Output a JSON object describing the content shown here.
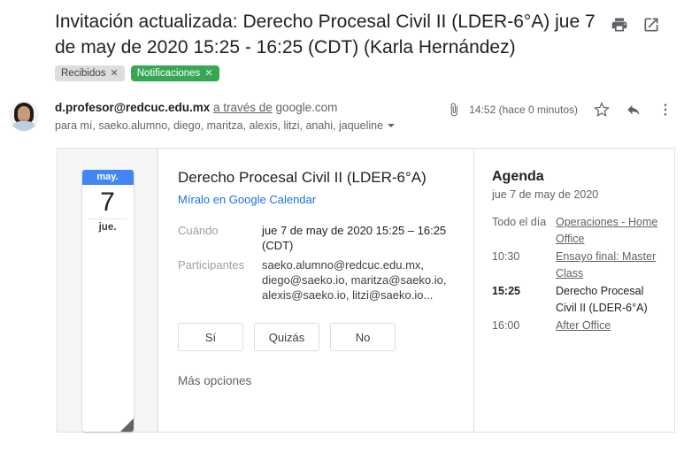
{
  "header": {
    "subject": "Invitación actualizada: Derecho Procesal Civil II (LDER-6°A) jue 7 de may de 2020 15:25 - 16:25 (CDT) (Karla Hernández)",
    "print_icon": "print-icon",
    "open_in_new_icon": "open-in-new-window-icon"
  },
  "labels": [
    {
      "text": "Recibidos",
      "remove": "✕",
      "color": "#ddddde"
    },
    {
      "text": "Notificaciones",
      "remove": "✕",
      "color": "#36a853"
    }
  ],
  "sender": {
    "address": "d.profesor@redcuc.edu.mx",
    "via": "a través de",
    "domain": "google.com",
    "recipients": "para mí, saeko.alumno, diego, maritza, alexis, litzi, anahi, jaqueline",
    "timestamp": "14:52 (hace 0 minutos)",
    "attachment_icon": "paperclip-icon",
    "star_icon": "star-icon",
    "reply_icon": "reply-icon",
    "more_icon": "more-options-icon",
    "avatar": "sender-avatar-photo"
  },
  "invite": {
    "date_card": {
      "month": "may.",
      "day": "7",
      "weekday": "jue."
    },
    "title": "Derecho Procesal Civil II (LDER-6°A)",
    "calendar_link": "Míralo en Google Calendar",
    "details": [
      {
        "label": "Cuándo",
        "value": "jue 7 de may de 2020 15:25 – 16:25 (CDT)",
        "strong": true
      },
      {
        "label": "Participantes",
        "value": "saeko.alumno@redcuc.edu.mx, diego@saeko.io, maritza@saeko.io, alexis@saeko.io, litzi@saeko.io...",
        "strong": false
      }
    ],
    "rsvp": [
      {
        "label": "Sí"
      },
      {
        "label": "Quizás"
      },
      {
        "label": "No"
      }
    ],
    "more_options": "Más opciones"
  },
  "agenda": {
    "title": "Agenda",
    "date": "jue 7 de may de 2020",
    "rows": [
      {
        "time": "Todo el día",
        "name": "Operaciones - Home Office",
        "current": false
      },
      {
        "time": "10:30",
        "name": "Ensayo final: Master Class",
        "current": false
      },
      {
        "time": "15:25",
        "name": "Derecho Procesal Civil II (LDER-6°A)",
        "current": true
      },
      {
        "time": "16:00",
        "name": "After Office",
        "current": false
      }
    ]
  },
  "colors": {
    "accent_blue": "#4285f4",
    "link_blue": "#1a73e8",
    "label_green": "#36a853"
  }
}
